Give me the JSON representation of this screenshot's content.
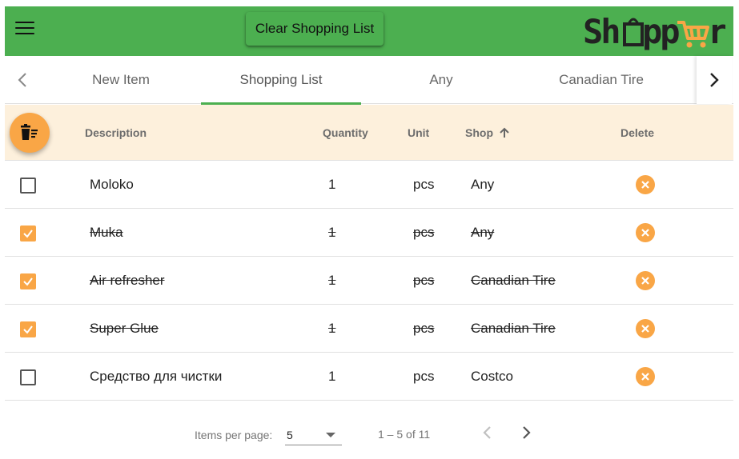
{
  "header": {
    "clear_button_label": "Clear Shopping List",
    "logo_text": "Shopper",
    "brand_color": "#4caf50",
    "accent_color": "#f9a646"
  },
  "tabs": [
    {
      "label": "New Item",
      "active": false
    },
    {
      "label": "Shopping List",
      "active": true
    },
    {
      "label": "Any",
      "active": false
    },
    {
      "label": "Canadian Tire",
      "active": false
    }
  ],
  "table": {
    "columns": {
      "description": "Description",
      "quantity": "Quantity",
      "unit": "Unit",
      "shop": "Shop",
      "delete": "Delete"
    },
    "sort": {
      "column": "shop",
      "direction": "asc"
    },
    "rows": [
      {
        "checked": false,
        "description": "Moloko",
        "quantity": "1",
        "unit": "pcs",
        "shop": "Any"
      },
      {
        "checked": true,
        "description": "Muka",
        "quantity": "1",
        "unit": "pcs",
        "shop": "Any"
      },
      {
        "checked": true,
        "description": "Air refresher",
        "quantity": "1",
        "unit": "pcs",
        "shop": "Canadian Tire"
      },
      {
        "checked": true,
        "description": "Super Glue",
        "quantity": "1",
        "unit": "pcs",
        "shop": "Canadian Tire"
      },
      {
        "checked": false,
        "description": "Средство для чистки",
        "quantity": "1",
        "unit": "pcs",
        "shop": "Costco"
      }
    ]
  },
  "paginator": {
    "items_per_page_label": "Items per page:",
    "page_size": "5",
    "range_label": "1 – 5 of 11"
  }
}
